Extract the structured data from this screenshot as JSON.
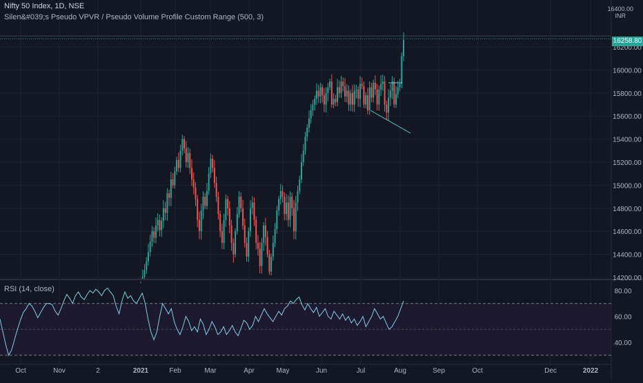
{
  "chart_data": [
    {
      "type": "candlestick",
      "title": "Nifty 50 Index, 1D, NSE",
      "indicator_label": "Silen&#039;s Pseudo VPVR / Pseudo Volume Profile Custom Range (500, 3)",
      "currency": [
        "16400.00",
        "INR"
      ],
      "last_price": "16258.80",
      "y_ticks": [
        "16200.00",
        "16000.00",
        "15800.00",
        "15600.00",
        "15400.00",
        "15200.00",
        "15000.00",
        "14800.00",
        "14600.00",
        "14400.00",
        "14200.00"
      ],
      "y_range": [
        14160,
        16560
      ],
      "x_ticks": [
        "Oct",
        "Nov",
        "2",
        "Dec",
        "2021",
        "Feb",
        "Mar",
        "Apr",
        "May",
        "Jun",
        "Jul",
        "Aug",
        "Sep",
        "Oct",
        "Dec",
        "2022"
      ],
      "candles_close": [
        14160,
        14205,
        14265,
        14340,
        14420,
        14510,
        14600,
        14545,
        14650,
        14700,
        14610,
        14690,
        14800,
        14760,
        14930,
        14890,
        15050,
        15000,
        15120,
        15220,
        15150,
        15300,
        15400,
        15320,
        15200,
        15280,
        15150,
        15050,
        14980,
        14880,
        14700,
        14600,
        14780,
        14900,
        14820,
        14950,
        15100,
        15230,
        15150,
        15020,
        14900,
        14750,
        14600,
        14500,
        14700,
        14880,
        14800,
        14650,
        14500,
        14400,
        14600,
        14750,
        14900,
        14800,
        14650,
        14500,
        14380,
        14600,
        14800,
        14850,
        14700,
        14500,
        14450,
        14300,
        14500,
        14650,
        14550,
        14400,
        14250,
        14380,
        14500,
        14620,
        14780,
        14880,
        14950,
        14900,
        14750,
        14850,
        14700,
        14900,
        14800,
        14600,
        14850,
        14950,
        15050,
        15200,
        15300,
        15420,
        15500,
        15580,
        15650,
        15700,
        15750,
        15820,
        15770,
        15850,
        15780,
        15700,
        15800,
        15850,
        15900,
        15700,
        15750,
        15720,
        15850,
        15800,
        15900,
        15860,
        15770,
        15820,
        15700,
        15800,
        15700,
        15820,
        15830,
        15750,
        15880,
        15860,
        15700,
        15780,
        15650,
        15850,
        15760,
        15890,
        15830,
        15700,
        15830,
        15880,
        15900,
        15700,
        15630,
        15760,
        15820,
        15900,
        15700,
        15790,
        15850,
        15880,
        16120,
        16258.8
      ],
      "rsi_label": "RSI (14, close)",
      "rsi_ticks": [
        "80.00",
        "60.00",
        "40.00"
      ],
      "rsi_range": [
        25,
        85
      ],
      "rsi_bands": [
        70,
        30
      ],
      "rsi_values": [
        58,
        48,
        38,
        30,
        34,
        42,
        50,
        57,
        63,
        66,
        70,
        68,
        64,
        59,
        63,
        67,
        70,
        70,
        69,
        64,
        61,
        66,
        72,
        77,
        74,
        70,
        76,
        79,
        75,
        73,
        77,
        80,
        78,
        81,
        79,
        76,
        80,
        82,
        79,
        76,
        68,
        62,
        72,
        79,
        74,
        76,
        72,
        70,
        74,
        78,
        70,
        58,
        48,
        42,
        48,
        60,
        70,
        66,
        62,
        66,
        56,
        50,
        46,
        52,
        60,
        56,
        49,
        52,
        48,
        58,
        54,
        46,
        50,
        56,
        52,
        46,
        48,
        52,
        46,
        49,
        53,
        48,
        45,
        51,
        57,
        55,
        50,
        53,
        60,
        56,
        61,
        66,
        62,
        59,
        56,
        60,
        64,
        61,
        66,
        68,
        72,
        70,
        73,
        75,
        69,
        65,
        70,
        66,
        63,
        67,
        60,
        63,
        66,
        60,
        58,
        64,
        61,
        58,
        62,
        57,
        60,
        55,
        58,
        53,
        56,
        60,
        52,
        56,
        60,
        66,
        62,
        58,
        60,
        55,
        50,
        52,
        56,
        60,
        66,
        72
      ]
    }
  ],
  "colors": {
    "up": "#26a69a",
    "down": "#ef5350",
    "rsi_line": "#7fd1e8",
    "trend_line": "#4fd6e0",
    "rsi_band_fill": "#1e1a33"
  }
}
